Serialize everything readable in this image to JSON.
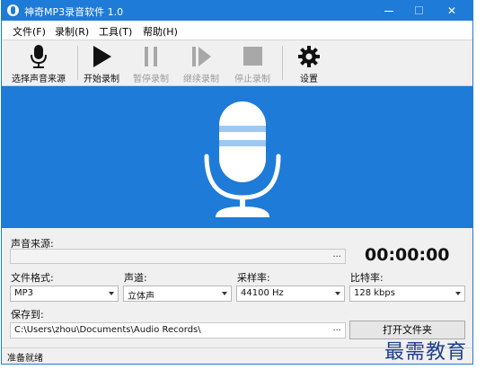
{
  "window": {
    "title": "神奇MP3录音软件 1.0",
    "controls": {
      "minimize": "minimize",
      "maximize": "maximize",
      "close": "✕"
    }
  },
  "menu": [
    "文件(F)",
    "录制(R)",
    "工具(T)",
    "帮助(H)"
  ],
  "toolbar": {
    "select_source": "选择声音来源",
    "start": "开始录制",
    "pause": "暂停录制",
    "resume": "继续录制",
    "stop": "停止录制",
    "settings": "设置"
  },
  "banner": {
    "icon": "microphone-icon",
    "color": "#1e7bd8"
  },
  "source": {
    "label": "声音来源:",
    "value": "",
    "browse": "..."
  },
  "timer": "00:00:00",
  "format": {
    "label": "文件格式:",
    "value": "MP3"
  },
  "channel": {
    "label": "声道:",
    "value": "立体声"
  },
  "samplerate": {
    "label": "采样率:",
    "value": "44100 Hz"
  },
  "bitrate": {
    "label": "比特率:",
    "value": "128 kbps"
  },
  "save": {
    "label": "保存到:",
    "path": "C:\\Users\\zhou\\Documents\\Audio Records\\",
    "browse": "...",
    "open_folder": "打开文件夹"
  },
  "status": "准备就绪",
  "watermark": "最需教育",
  "colors": {
    "accent": "#1e7bd8",
    "watermark": "#1c3f8c"
  }
}
